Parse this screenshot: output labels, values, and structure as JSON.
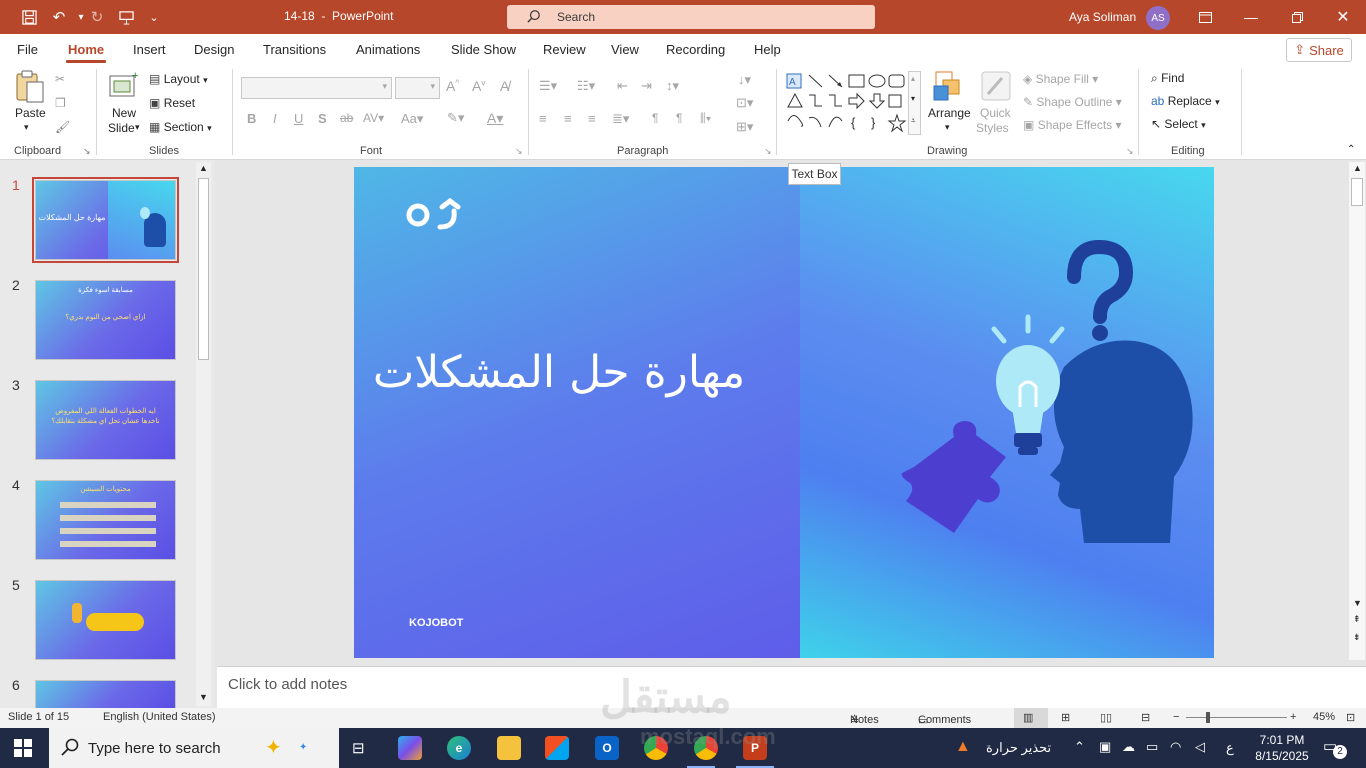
{
  "titlebar": {
    "doc_name": "14-18",
    "separator": "-",
    "app_name": "PowerPoint",
    "search_label": "Search",
    "user_name": "Aya Soliman",
    "user_initials": "AS"
  },
  "menu": {
    "tabs": [
      "File",
      "Home",
      "Insert",
      "Design",
      "Transitions",
      "Animations",
      "Slide Show",
      "Review",
      "View",
      "Recording",
      "Help"
    ],
    "active": "Home",
    "share_label": "Share"
  },
  "ribbon": {
    "clipboard": {
      "label": "Clipboard",
      "paste": "Paste"
    },
    "slides": {
      "label": "Slides",
      "new_slide_1": "New",
      "new_slide_2": "Slide",
      "layout": "Layout",
      "reset": "Reset",
      "section": "Section"
    },
    "font": {
      "label": "Font"
    },
    "paragraph": {
      "label": "Paragraph"
    },
    "drawing": {
      "label": "Drawing",
      "arrange": "Arrange",
      "quick_styles_1": "Quick",
      "quick_styles_2": "Styles",
      "shape_fill": "Shape Fill",
      "shape_outline": "Shape Outline",
      "shape_effects": "Shape Effects"
    },
    "editing": {
      "label": "Editing",
      "find": "Find",
      "replace": "Replace",
      "select": "Select"
    }
  },
  "tooltip": "Text Box",
  "slides": [
    {
      "num": "1",
      "text": "مهارة حل المشكلات"
    },
    {
      "num": "2",
      "text": "مسابقة اسوء فكرة",
      "sub": "ازاي اصحي من النوم بدري؟"
    },
    {
      "num": "3",
      "text": "ايه الخطوات الفعالة اللي المفروض ناخدها عشان تحل اي مشكلة بتقابلك؟"
    },
    {
      "num": "4",
      "text": "محتويات السيشن"
    },
    {
      "num": "5",
      "text": ""
    },
    {
      "num": "6",
      "text": ""
    }
  ],
  "current_slide": {
    "title": "مهارة حل المشكلات",
    "footer": "KOJOBOT"
  },
  "notes_placeholder": "Click to add notes",
  "status": {
    "slide_info": "Slide 1 of 15",
    "language": "English (United States)",
    "notes": "Notes",
    "comments": "Comments",
    "zoom": "45%"
  },
  "taskbar": {
    "search_placeholder": "Type here to search",
    "weather": "تحذير حرارة",
    "time": "7:01 PM",
    "date": "8/15/2025",
    "lang": "ع",
    "notif_count": "2"
  },
  "watermark": {
    "arabic": "مستقل",
    "latin": "mostaql.com"
  }
}
